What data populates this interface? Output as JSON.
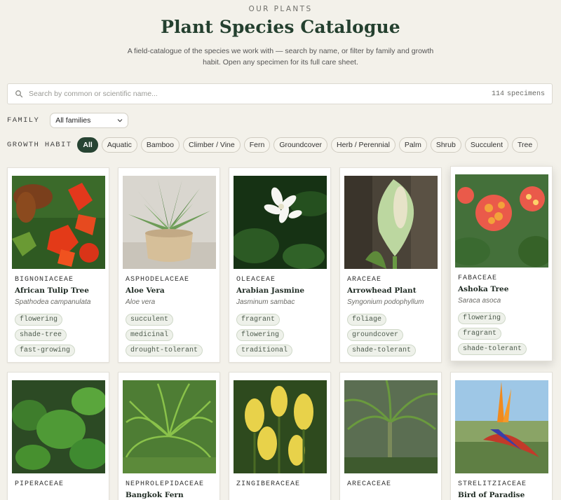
{
  "header": {
    "eyebrow": "OUR PLANTS",
    "title": "Plant Species Catalogue",
    "subtitle": "A field-catalogue of the species we work with — search by name, or filter by family and growth habit. Open any specimen for its full care sheet."
  },
  "search": {
    "placeholder": "Search by common or scientific name...",
    "count_number": "114",
    "count_label": "specimens",
    "icon": "search-icon"
  },
  "filters": {
    "family_label": "FAMILY",
    "family_selected": "All families",
    "habit_label": "GROWTH HABIT",
    "habits": [
      "All",
      "Aquatic",
      "Bamboo",
      "Climber / Vine",
      "Fern",
      "Groundcover",
      "Herb / Perennial",
      "Palm",
      "Shrub",
      "Succulent",
      "Tree"
    ],
    "active_habit": "All"
  },
  "colors": {
    "accent": "#274433",
    "background": "#f3f1ea",
    "tag_bg": "#eef1ea"
  },
  "cards": [
    {
      "family": "BIGNONIACEAE",
      "name": "African Tulip Tree",
      "scientific": "Spathodea campanulata",
      "tags": [
        "flowering",
        "shade-tree",
        "fast-growing"
      ]
    },
    {
      "family": "ASPHODELACEAE",
      "name": "Aloe Vera",
      "scientific": "Aloe vera",
      "tags": [
        "succulent",
        "medicinal",
        "drought-tolerant"
      ]
    },
    {
      "family": "OLEACEAE",
      "name": "Arabian Jasmine",
      "scientific": "Jasminum sambac",
      "tags": [
        "fragrant",
        "flowering",
        "traditional"
      ]
    },
    {
      "family": "ARACEAE",
      "name": "Arrowhead Plant",
      "scientific": "Syngonium podophyllum",
      "tags": [
        "foliage",
        "groundcover",
        "shade-tolerant"
      ]
    },
    {
      "family": "FABACEAE",
      "name": "Ashoka Tree",
      "scientific": "Saraca asoca",
      "tags": [
        "flowering",
        "fragrant",
        "shade-tolerant"
      ]
    },
    {
      "family": "PIPERACEAE",
      "name": "",
      "scientific": "",
      "tags": []
    },
    {
      "family": "NEPHROLEPIDACEAE",
      "name": "Bangkok Fern",
      "scientific": "",
      "tags": []
    },
    {
      "family": "ZINGIBERACEAE",
      "name": "",
      "scientific": "",
      "tags": []
    },
    {
      "family": "ARECACEAE",
      "name": "",
      "scientific": "",
      "tags": []
    },
    {
      "family": "STRELITZIACEAE",
      "name": "Bird of Paradise",
      "scientific": "",
      "tags": []
    }
  ]
}
